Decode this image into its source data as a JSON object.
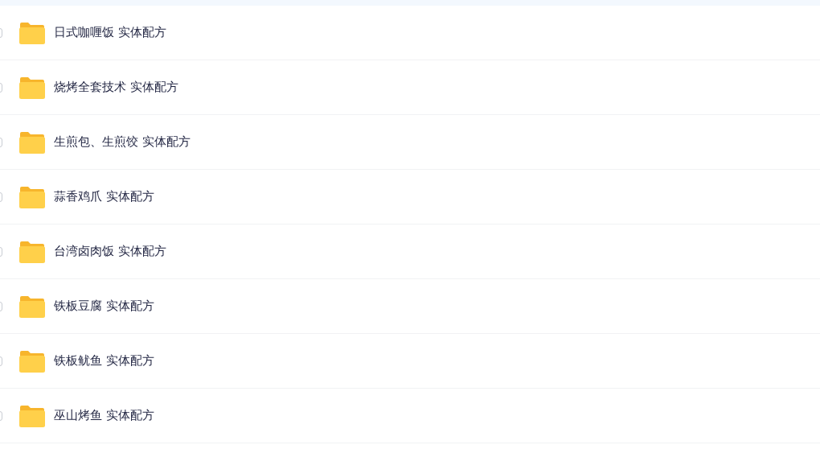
{
  "files": [
    {
      "name": "日式咖喱饭 实体配方",
      "checked": false
    },
    {
      "name": "烧烤全套技术 实体配方",
      "checked": false
    },
    {
      "name": "生煎包、生煎饺 实体配方",
      "checked": false
    },
    {
      "name": "蒜香鸡爪 实体配方",
      "checked": false
    },
    {
      "name": "台湾卤肉饭 实体配方",
      "checked": false
    },
    {
      "name": "铁板豆腐 实体配方",
      "checked": false
    },
    {
      "name": "铁板鱿鱼 实体配方",
      "checked": false
    },
    {
      "name": "巫山烤鱼 实体配方",
      "checked": false
    }
  ]
}
